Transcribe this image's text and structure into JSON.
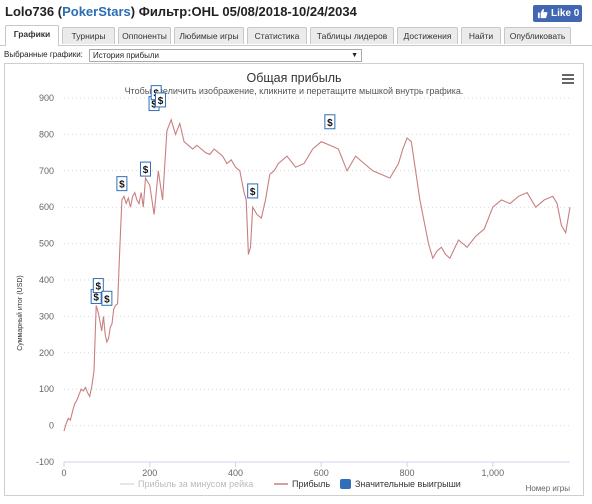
{
  "header": {
    "player": "Lolo736",
    "site_open": "(",
    "site": "PokerStars",
    "site_close": ")",
    "filter_text": "Фильтр:OHL 05/08/2018-10/24/2034",
    "like_label": "Like 0",
    "like_icon": "thumbs-up-icon"
  },
  "tabs": [
    {
      "label": "Графики",
      "active": true
    },
    {
      "label": "Турниры",
      "active": false
    },
    {
      "label": "Оппоненты",
      "active": false
    },
    {
      "label": "Любимые игры",
      "active": false
    },
    {
      "label": "Статистика",
      "active": false
    },
    {
      "label": "Таблицы лидеров",
      "active": false
    },
    {
      "label": "Достижения",
      "active": false
    },
    {
      "label": "Найти",
      "active": false
    },
    {
      "label": "Опубликовать",
      "active": false
    }
  ],
  "graph_select": {
    "label": "Выбранные графики:",
    "value": "История прибыли"
  },
  "colors": {
    "link": "#2a6db5",
    "profit_line": "#c97f80",
    "marker": "#2e6fb8",
    "like_button": "#4267b2"
  },
  "chart_data": {
    "type": "line",
    "title": "Общая прибыль",
    "subtitle": "Чтобы увеличить изображение, кликните и перетащите мышкой внутрь графика.",
    "ylabel": "Суммарный итог (USD)",
    "xlabel": "Номер игры",
    "xlim": [
      0,
      1180
    ],
    "ylim": [
      -100,
      900
    ],
    "x_ticks": [
      0,
      200,
      400,
      600,
      800,
      1000
    ],
    "x_tick_labels": [
      "0",
      "200",
      "400",
      "600",
      "800",
      "1,000"
    ],
    "y_ticks": [
      -100,
      0,
      100,
      200,
      300,
      400,
      500,
      600,
      700,
      800,
      900
    ],
    "grid": "horizontal dotted",
    "menu_icon": "hamburger-menu-icon",
    "legend": [
      "Прибыль за минусом рейка",
      "Прибыль",
      "Значительные выигрыши"
    ],
    "series": [
      {
        "name": "Прибыль",
        "x": [
          0,
          5,
          10,
          15,
          20,
          25,
          30,
          35,
          40,
          45,
          50,
          55,
          60,
          65,
          70,
          75,
          80,
          85,
          88,
          92,
          96,
          100,
          104,
          108,
          112,
          116,
          120,
          125,
          130,
          135,
          140,
          145,
          150,
          155,
          160,
          165,
          170,
          175,
          180,
          185,
          190,
          200,
          210,
          220,
          230,
          240,
          250,
          260,
          270,
          280,
          290,
          300,
          310,
          320,
          330,
          340,
          350,
          360,
          370,
          380,
          390,
          400,
          410,
          420,
          425,
          430,
          435,
          440,
          450,
          460,
          470,
          480,
          490,
          500,
          520,
          540,
          560,
          580,
          600,
          620,
          640,
          660,
          680,
          700,
          720,
          740,
          760,
          780,
          790,
          800,
          810,
          820,
          830,
          840,
          850,
          860,
          870,
          880,
          890,
          900,
          920,
          940,
          960,
          980,
          1000,
          1020,
          1040,
          1060,
          1080,
          1100,
          1120,
          1140,
          1150,
          1160,
          1170,
          1180
        ],
        "y": [
          -15,
          5,
          20,
          15,
          40,
          60,
          70,
          85,
          100,
          95,
          105,
          90,
          80,
          110,
          150,
          330,
          310,
          280,
          260,
          300,
          250,
          230,
          240,
          270,
          280,
          320,
          330,
          335,
          480,
          620,
          630,
          610,
          625,
          600,
          630,
          640,
          620,
          610,
          640,
          600,
          680,
          660,
          580,
          700,
          620,
          810,
          840,
          800,
          830,
          780,
          770,
          760,
          770,
          760,
          750,
          745,
          760,
          750,
          740,
          720,
          730,
          710,
          700,
          640,
          620,
          470,
          490,
          600,
          580,
          570,
          620,
          690,
          700,
          720,
          740,
          710,
          720,
          760,
          780,
          770,
          760,
          700,
          740,
          720,
          700,
          690,
          680,
          720,
          760,
          790,
          780,
          700,
          620,
          560,
          500,
          460,
          480,
          490,
          470,
          460,
          510,
          490,
          520,
          540,
          600,
          620,
          610,
          630,
          640,
          600,
          620,
          630,
          610,
          550,
          530,
          600
        ]
      }
    ],
    "significant_wins": [
      {
        "x": 75,
        "y": 330
      },
      {
        "x": 80,
        "y": 360
      },
      {
        "x": 100,
        "y": 325
      },
      {
        "x": 135,
        "y": 640
      },
      {
        "x": 190,
        "y": 680
      },
      {
        "x": 210,
        "y": 860
      },
      {
        "x": 215,
        "y": 890
      },
      {
        "x": 225,
        "y": 870
      },
      {
        "x": 440,
        "y": 620
      },
      {
        "x": 620,
        "y": 810
      }
    ]
  }
}
